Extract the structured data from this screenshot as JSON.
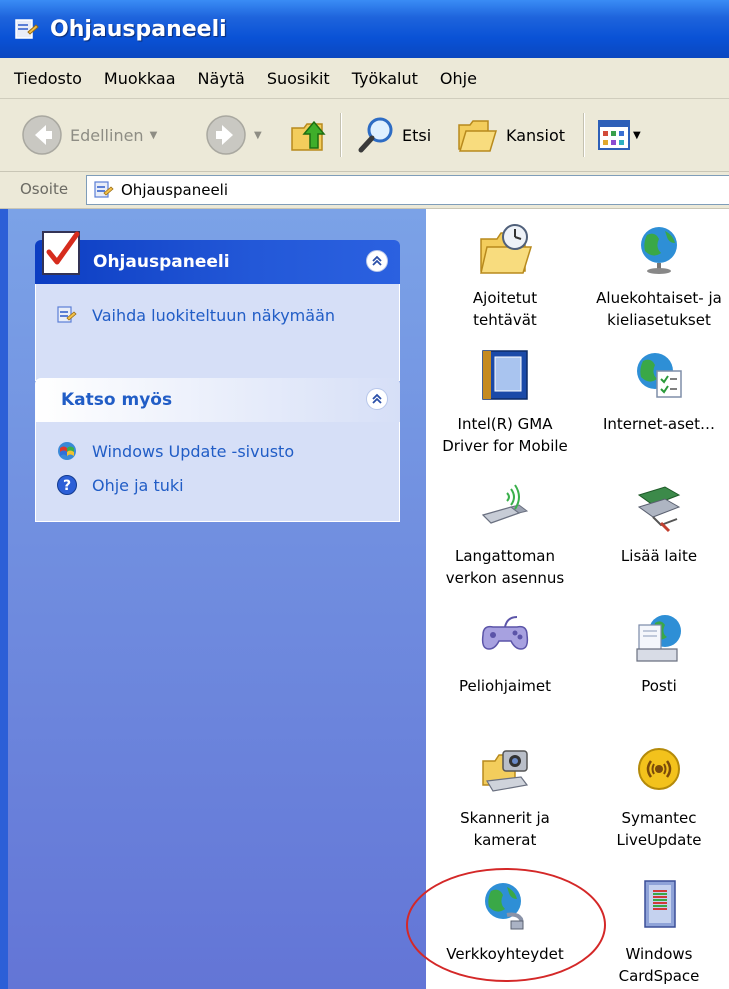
{
  "window": {
    "title": "Ohjauspaneeli"
  },
  "menu": [
    "Tiedosto",
    "Muokkaa",
    "Näytä",
    "Suosikit",
    "Työkalut",
    "Ohje"
  ],
  "toolbar": {
    "back_label": "Edellinen",
    "search_label": "Etsi",
    "folders_label": "Kansiot"
  },
  "address": {
    "label": "Osoite",
    "value": "Ohjauspaneeli"
  },
  "taskpane": {
    "control_panel_box": {
      "title": "Ohjauspaneeli",
      "switch_view_label": "Vaihda luokiteltuun näkymään"
    },
    "see_also_box": {
      "title": "Katso myös",
      "windows_update_label": "Windows Update -sivusto",
      "help_label": "Ohje ja tuki"
    }
  },
  "items": [
    {
      "label": "Ajoitetut\ntehtävät",
      "icon": "scheduled-tasks-icon"
    },
    {
      "label": "Aluekohtaiset- ja\nkieliasetukset",
      "icon": "regional-language-icon"
    },
    {
      "label": "Intel(R) GMA\nDriver for Mobile",
      "icon": "intel-gma-icon"
    },
    {
      "label": "Internet-aset…",
      "icon": "internet-options-icon"
    },
    {
      "label": "Langattoman\nverkon asennus",
      "icon": "wireless-setup-icon"
    },
    {
      "label": "Lisää laite",
      "icon": "add-hardware-icon"
    },
    {
      "label": "Peliohjaimet",
      "icon": "game-controllers-icon"
    },
    {
      "label": "Posti",
      "icon": "mail-icon"
    },
    {
      "label": "Skannerit ja\nkamerat",
      "icon": "scanners-cameras-icon"
    },
    {
      "label": "Symantec\nLiveUpdate",
      "icon": "symantec-liveupdate-icon"
    },
    {
      "label": "Verkkoyhteydet",
      "icon": "network-connections-icon"
    },
    {
      "label": "Windows\nCardSpace",
      "icon": "windows-cardspace-icon"
    }
  ],
  "colors": {
    "titlebar": "#0a52d6",
    "taskpane": "#6375d6",
    "link": "#215dc6",
    "highlight_ellipse": "#d42828"
  }
}
